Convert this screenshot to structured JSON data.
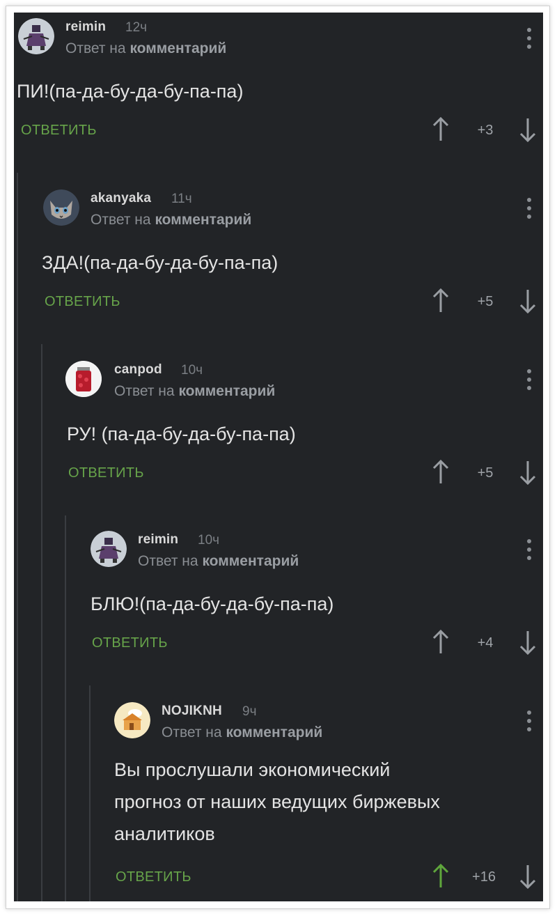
{
  "comments": [
    {
      "username": "reimin",
      "time": "12ч",
      "reply_prefix": "Ответ на",
      "reply_target": "комментарий",
      "text": "ПИ!(па-да-бу-да-бу-па-па)",
      "reply_label": "ОТВЕТИТЬ",
      "score": "+3"
    },
    {
      "username": "akanyaka",
      "time": "11ч",
      "reply_prefix": "Ответ на",
      "reply_target": "комментарий",
      "text": "ЗДА!(па-да-бу-да-бу-па-па)",
      "reply_label": "ОТВЕТИТЬ",
      "score": "+5"
    },
    {
      "username": "canpod",
      "time": "10ч",
      "reply_prefix": "Ответ на",
      "reply_target": "комментарий",
      "text": "РУ! (па-да-бу-да-бу-па-па)",
      "reply_label": "ОТВЕТИТЬ",
      "score": "+5"
    },
    {
      "username": "reimin",
      "time": "10ч",
      "reply_prefix": "Ответ на",
      "reply_target": "комментарий",
      "text": "БЛЮ!(па-да-бу-да-бу-па-па)",
      "reply_label": "ОТВЕТИТЬ",
      "score": "+4"
    },
    {
      "username": "NOJIKNH",
      "time": "9ч",
      "reply_prefix": "Ответ на",
      "reply_target": "комментарий",
      "text_lines": [
        "Вы прослушали экономический",
        "прогноз от наших ведущих биржевых",
        "аналитиков"
      ],
      "reply_label": "ОТВЕТИТЬ",
      "score": "+16",
      "upvoted": true
    }
  ],
  "colors": {
    "background": "#222427",
    "reply_button": "#67a44a",
    "upvote_active": "#5fa63c",
    "arrow": "#9a9ea3"
  },
  "icons": [
    "kebab-menu-icon",
    "arrow-up-icon",
    "arrow-down-icon",
    "avatar"
  ]
}
